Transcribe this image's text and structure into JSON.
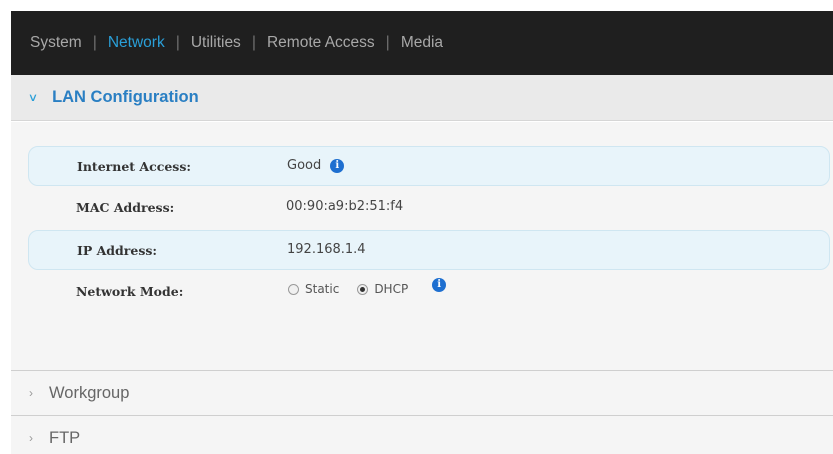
{
  "nav": {
    "items": [
      {
        "label": "System",
        "active": false
      },
      {
        "label": "Network",
        "active": true
      },
      {
        "label": "Utilities",
        "active": false
      },
      {
        "label": "Remote Access",
        "active": false
      },
      {
        "label": "Media",
        "active": false
      }
    ],
    "separator": "|"
  },
  "lan": {
    "title": "LAN Configuration",
    "expanded": true,
    "internet_access": {
      "label": "Internet Access:",
      "value": "Good",
      "info_icon": "info-icon"
    },
    "mac_address": {
      "label": "MAC Address:",
      "value": "00:90:a9:b2:51:f4"
    },
    "ip_address": {
      "label": "IP Address:",
      "value": "192.168.1.4"
    },
    "network_mode": {
      "label": "Network Mode:",
      "options": [
        {
          "label": "Static",
          "selected": false
        },
        {
          "label": "DHCP",
          "selected": true
        }
      ],
      "info_icon": "info-icon"
    }
  },
  "workgroup": {
    "title": "Workgroup",
    "expanded": false
  },
  "ftp": {
    "title": "FTP",
    "expanded": false
  },
  "colors": {
    "nav_bg": "#1f1f1f",
    "nav_active": "#2a9fd8",
    "section_title": "#2a7fc3",
    "row_highlight": "#e8f4fa",
    "info_icon": "#1e6fd0"
  }
}
